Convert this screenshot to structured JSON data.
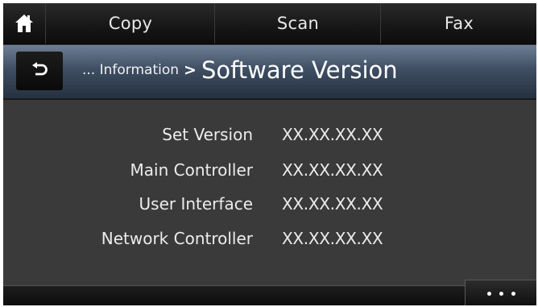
{
  "topbar": {
    "home_icon": "home-icon",
    "tabs": [
      {
        "label": "Copy"
      },
      {
        "label": "Scan"
      },
      {
        "label": "Fax"
      }
    ]
  },
  "titlebar": {
    "back_icon": "back-arrow-icon",
    "breadcrumb": "... Information",
    "separator": ">",
    "title": "Software Version"
  },
  "versions": [
    {
      "label": "Set Version",
      "value": "XX.XX.XX.XX"
    },
    {
      "label": "Main Controller",
      "value": "XX.XX.XX.XX"
    },
    {
      "label": "User Interface",
      "value": "XX.XX.XX.XX"
    },
    {
      "label": "Network Controller",
      "value": "XX.XX.XX.XX"
    }
  ],
  "bottombar": {
    "more_icon": "more-dots-icon"
  },
  "colors": {
    "background": "#3a3a3a",
    "title_bar": "#3f4e63",
    "text": "#ececec"
  }
}
